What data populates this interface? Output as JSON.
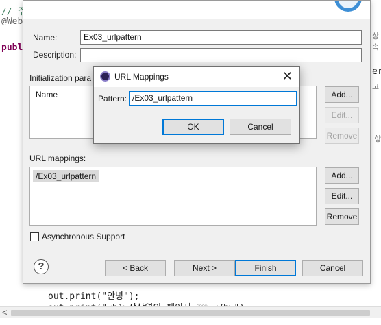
{
  "editor": {
    "line1": "// 주",
    "line2": "@Web",
    "line3": "publ",
    "line4": "out.print(\"안녕\");",
    "line5": "out.print(\"<h1>장상연의 페이지 ♡♡ </h>\");",
    "right_frag1": "상속",
    "right_frag2": "er",
    "right_frag3": "고",
    "right_frag4": "항"
  },
  "wizard": {
    "name_label": "Name:",
    "name_value": "Ex03_urlpattern",
    "description_label": "Description:",
    "description_value": "",
    "init_params_label": "Initialization para",
    "init_table_header": "Name",
    "init_add": "Add...",
    "init_edit": "Edit...",
    "init_remove": "Remove",
    "url_mappings_label": "URL mappings:",
    "url_items": [
      "/Ex03_urlpattern"
    ],
    "url_add": "Add...",
    "url_edit": "Edit...",
    "url_remove": "Remove",
    "async_label": "Asynchronous Support",
    "async_checked": false,
    "help_glyph": "?",
    "back": "< Back",
    "next": "Next >",
    "finish": "Finish",
    "cancel": "Cancel"
  },
  "url_dialog": {
    "title": "URL Mappings",
    "close_glyph": "✕",
    "pattern_label": "Pattern:",
    "pattern_value": "/Ex03_urlpattern",
    "ok": "OK",
    "cancel": "Cancel"
  },
  "scrollbar": {
    "left_arrow": "<"
  },
  "colors": {
    "accent": "#0078d7",
    "dialog_bg": "#f0f0f0",
    "selection": "#dadada"
  }
}
